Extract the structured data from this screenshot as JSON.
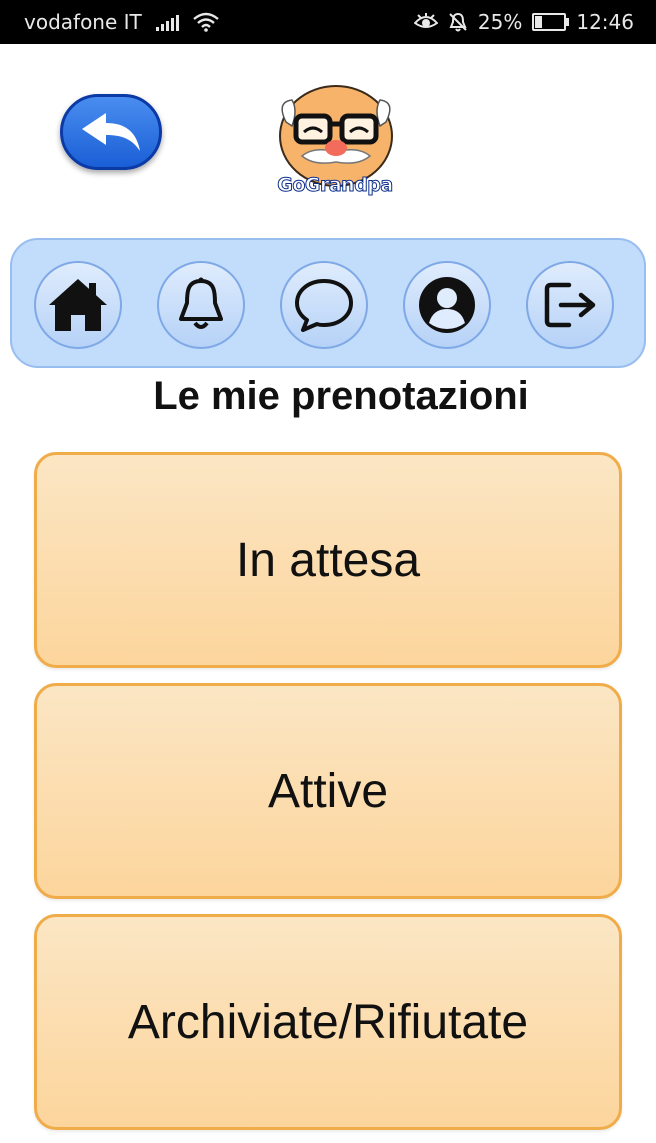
{
  "status_bar": {
    "carrier": "vodafone IT",
    "battery_percent": "25%",
    "battery_level": 0.25,
    "time": "12:46",
    "icons": [
      "signal-icon",
      "wifi-icon",
      "eye-icon",
      "bell-off-icon",
      "battery-icon"
    ]
  },
  "header": {
    "back_icon": "back-arrow-icon",
    "logo_text": "GoGrandpa"
  },
  "nav": {
    "items": [
      {
        "icon": "home-icon",
        "label": "Home"
      },
      {
        "icon": "bell-icon",
        "label": "Notifications"
      },
      {
        "icon": "chat-bubble-icon",
        "label": "Messages"
      },
      {
        "icon": "user-icon",
        "label": "Profile"
      },
      {
        "icon": "logout-icon",
        "label": "Logout"
      }
    ]
  },
  "main": {
    "title": "Le mie prenotazioni",
    "options": [
      {
        "label": "In attesa"
      },
      {
        "label": "Attive"
      },
      {
        "label": "Archiviate/Rifiutate"
      }
    ]
  },
  "colors": {
    "option_border": "#f0ac49",
    "option_fill": "#fcd59c",
    "nav_background": "#c2dcfb",
    "back_button": "#1a5fd6"
  }
}
